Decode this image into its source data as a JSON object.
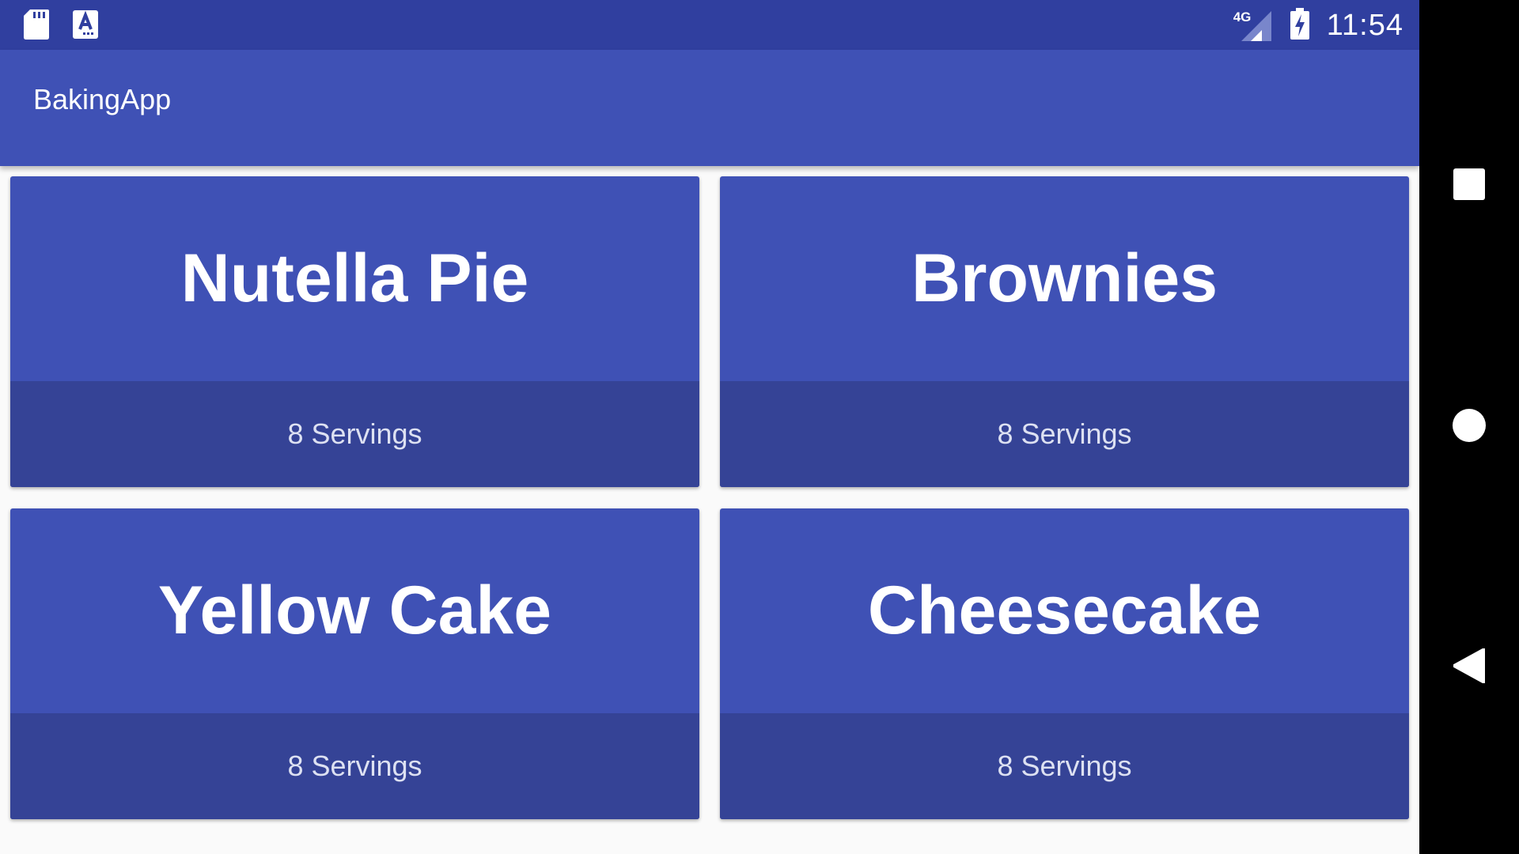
{
  "status_bar": {
    "time": "11:54",
    "network": "4G",
    "icons": [
      "sd-card-icon",
      "a-notification-icon",
      "signal-icon",
      "battery-charging-icon"
    ]
  },
  "app_bar": {
    "title": "BakingApp"
  },
  "recipes": [
    {
      "name": "Nutella Pie",
      "servings": "8 Servings"
    },
    {
      "name": "Brownies",
      "servings": "8 Servings"
    },
    {
      "name": "Yellow Cake",
      "servings": "8 Servings"
    },
    {
      "name": "Cheesecake",
      "servings": "8 Servings"
    }
  ],
  "nav_bar": {
    "buttons": [
      "recents-square-icon",
      "home-circle-icon",
      "back-triangle-icon"
    ]
  },
  "colors": {
    "primary": "#3f51b5",
    "primary_dark": "#303f9f",
    "card_footer": "#354396",
    "background": "#fafafa"
  }
}
